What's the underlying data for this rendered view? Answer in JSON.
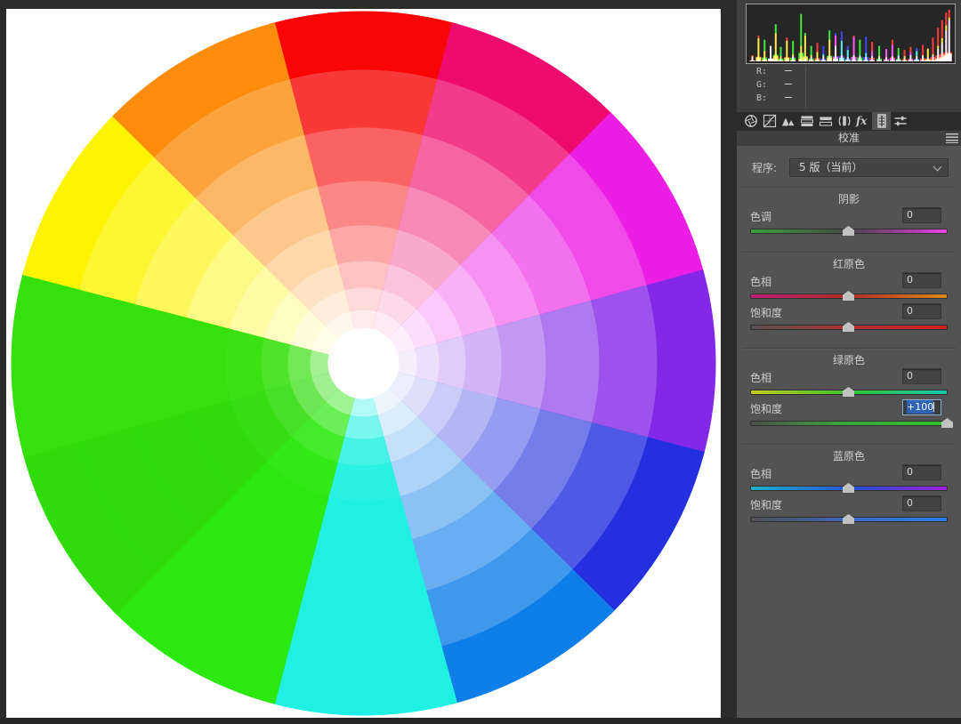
{
  "window": {
    "bg": "#2B2B2B"
  },
  "histogram": {
    "bg": "#262626",
    "border": "#9B9B9B",
    "rgb": [
      {
        "label": "R:",
        "value": "—"
      },
      {
        "label": "G:",
        "value": "—"
      },
      {
        "label": "B:",
        "value": "—"
      }
    ],
    "spikes": [
      [
        0.02,
        0.12,
        0.1,
        0.08
      ],
      [
        0.05,
        0.5,
        0.45,
        0.05
      ],
      [
        0.08,
        0.2,
        0.42,
        0.06
      ],
      [
        0.11,
        0.3,
        0.3,
        0.3
      ],
      [
        0.135,
        0.55,
        0.72,
        0.06
      ],
      [
        0.16,
        0.1,
        0.28,
        0.05
      ],
      [
        0.19,
        0.46,
        0.4,
        0.05
      ],
      [
        0.22,
        0.14,
        0.4,
        0.1
      ],
      [
        0.26,
        0.3,
        0.92,
        0.05
      ],
      [
        0.28,
        0.5,
        0.55,
        0.05
      ],
      [
        0.31,
        0.12,
        0.3,
        0.08
      ],
      [
        0.34,
        0.36,
        0.18,
        0.05
      ],
      [
        0.37,
        0.1,
        0.14,
        0.3
      ],
      [
        0.4,
        0.42,
        0.6,
        0.1
      ],
      [
        0.43,
        0.5,
        0.3,
        0.55
      ],
      [
        0.46,
        0.12,
        0.4,
        0.58
      ],
      [
        0.49,
        0.08,
        0.22,
        0.3
      ],
      [
        0.52,
        0.5,
        0.12,
        0.48
      ],
      [
        0.55,
        0.1,
        0.42,
        0.12
      ],
      [
        0.58,
        0.08,
        0.16,
        0.48
      ],
      [
        0.61,
        0.38,
        0.1,
        0.2
      ],
      [
        0.645,
        0.1,
        0.3,
        0.08
      ],
      [
        0.68,
        0.24,
        0.08,
        0.24
      ],
      [
        0.71,
        0.42,
        0.1,
        0.32
      ],
      [
        0.74,
        0.1,
        0.26,
        0.12
      ],
      [
        0.77,
        0.22,
        0.1,
        0.06
      ],
      [
        0.8,
        0.28,
        0.12,
        0.18
      ],
      [
        0.83,
        0.1,
        0.2,
        0.26
      ],
      [
        0.86,
        0.32,
        0.12,
        0.1
      ],
      [
        0.885,
        0.26,
        0.24,
        0.08
      ],
      [
        0.91,
        0.46,
        0.14,
        0.12
      ],
      [
        0.935,
        0.65,
        0.3,
        0.24
      ],
      [
        0.955,
        0.8,
        0.45,
        0.35
      ],
      [
        0.975,
        0.95,
        0.7,
        0.6
      ],
      [
        0.99,
        1.0,
        0.85,
        0.8
      ]
    ]
  },
  "tabs": [
    {
      "name": "basic-adjustments",
      "selected": false
    },
    {
      "name": "tone-curve",
      "selected": false
    },
    {
      "name": "detail",
      "selected": false
    },
    {
      "name": "hsl-grayscale",
      "selected": false
    },
    {
      "name": "split-toning",
      "selected": false
    },
    {
      "name": "lens-corrections",
      "selected": false
    },
    {
      "name": "effects",
      "selected": false
    },
    {
      "name": "camera-calibration",
      "selected": true
    },
    {
      "name": "presets",
      "selected": false
    }
  ],
  "panel": {
    "title": "校准",
    "profile_label": "程序:",
    "profile_value": "5 版（当前）"
  },
  "sections": [
    {
      "title": "阴影",
      "sliders": [
        {
          "label": "色调",
          "value": "0",
          "pos": 0.5,
          "selected": false,
          "stops": [
            [
              "#3AA23A",
              0
            ],
            [
              "#474747",
              50
            ],
            [
              "#B83CB8",
              85
            ],
            [
              "#EC48EC",
              100
            ]
          ]
        }
      ]
    },
    {
      "title": "红原色",
      "sliders": [
        {
          "label": "色相",
          "value": "0",
          "pos": 0.5,
          "selected": false,
          "stops": [
            [
              "#C21C78",
              0
            ],
            [
              "#AE3028",
              50
            ],
            [
              "#DE8618",
              100
            ]
          ]
        },
        {
          "label": "饱和度",
          "value": "0",
          "pos": 0.5,
          "selected": false,
          "stops": [
            [
              "#565050",
              0
            ],
            [
              "#B43030",
              55
            ],
            [
              "#D02020",
              100
            ]
          ]
        }
      ]
    },
    {
      "title": "绿原色",
      "sliders": [
        {
          "label": "色相",
          "value": "0",
          "pos": 0.5,
          "selected": false,
          "stops": [
            [
              "#C6CA1E",
              0
            ],
            [
              "#34C434",
              52
            ],
            [
              "#16C6AE",
              100
            ]
          ]
        },
        {
          "label": "饱和度",
          "value": "+100",
          "pos": 1.0,
          "selected": true,
          "stops": [
            [
              "#4E4E4E",
              0
            ],
            [
              "#3AA43A",
              45
            ],
            [
              "#2FC42F",
              100
            ]
          ]
        }
      ]
    },
    {
      "title": "蓝原色",
      "sliders": [
        {
          "label": "色相",
          "value": "0",
          "pos": 0.5,
          "selected": false,
          "stops": [
            [
              "#1CB0C6",
              0
            ],
            [
              "#2C4CD6",
              55
            ],
            [
              "#9C22DE",
              100
            ]
          ]
        },
        {
          "label": "饱和度",
          "value": "0",
          "pos": 0.5,
          "selected": false,
          "stops": [
            [
              "#4E4E4E",
              0
            ],
            [
              "#3A6CC8",
              55
            ],
            [
              "#2E7AE8",
              100
            ]
          ]
        }
      ]
    }
  ],
  "wheel": {
    "center_color": "#FFFFFF",
    "ring_radii": [
      40,
      60,
      85,
      115,
      155,
      205,
      265,
      330,
      396
    ],
    "profiles": {
      "standard": [
        0.08,
        0.15,
        0.24,
        0.35,
        0.48,
        0.63,
        0.8,
        1.0
      ],
      "boost-green": [
        0.45,
        0.7,
        0.88,
        0.97,
        1,
        1,
        1,
        1
      ],
      "boost-cyan": [
        0.35,
        0.6,
        0.82,
        0.95,
        1,
        1,
        1,
        1
      ]
    },
    "sectors": [
      {
        "name": "red",
        "color": "#F80606",
        "profile": "standard"
      },
      {
        "name": "rose",
        "color": "#EF0A6E",
        "profile": "standard"
      },
      {
        "name": "magenta",
        "color": "#EC1EE4",
        "profile": "standard"
      },
      {
        "name": "violet",
        "color": "#8228E6",
        "profile": "standard"
      },
      {
        "name": "blue",
        "color": "#2430E0",
        "profile": "standard"
      },
      {
        "name": "azure",
        "color": "#107EE8",
        "profile": "standard"
      },
      {
        "name": "cyan",
        "color": "#1FF0E1",
        "profile": "boost-cyan"
      },
      {
        "name": "spring-green",
        "color": "#2BE80E",
        "profile": "boost-green"
      },
      {
        "name": "green",
        "color": "#2FDC0A",
        "profile": "boost-green"
      },
      {
        "name": "chartreuse",
        "color": "#36E00C",
        "profile": "boost-green"
      },
      {
        "name": "yellow",
        "color": "#FEF400",
        "profile": "standard"
      },
      {
        "name": "orange",
        "color": "#FB8C0E",
        "profile": "standard"
      }
    ]
  },
  "colors": {
    "selection_blue": "#2E62B4",
    "panel_bg": "#535353",
    "histo_zone_bg": "#3E3E3E",
    "tab_strip_bg": "#2B2B2B",
    "title_bar_bg": "#3F3F3F",
    "divider": "#474747",
    "handle": "#C2C2C2",
    "value_box_bg": "#434343"
  }
}
